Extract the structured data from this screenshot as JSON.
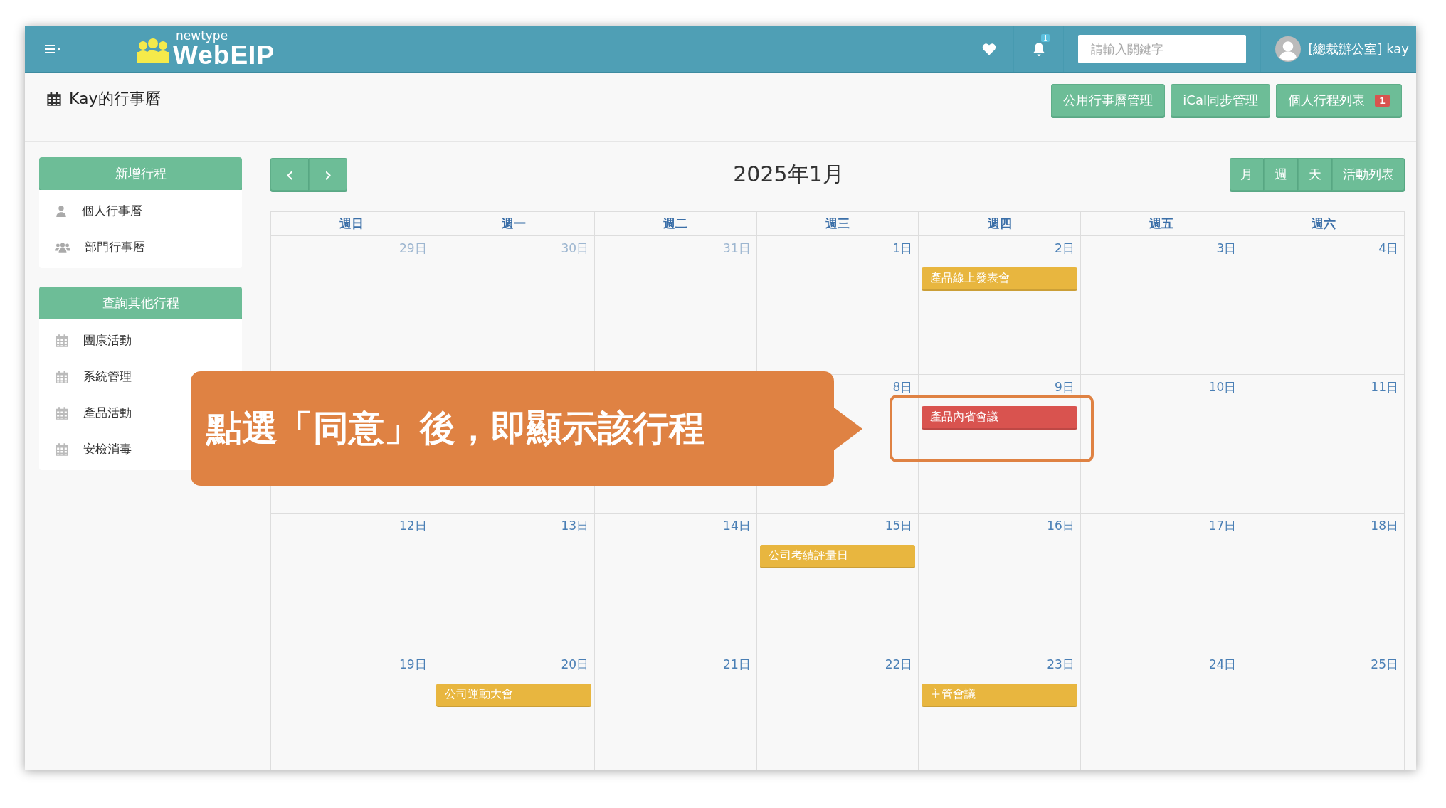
{
  "header": {
    "logo_small": "newtype",
    "logo_big": "WebEIP",
    "notification_count": "1",
    "search": {
      "placeholder": "請輸入關鍵字"
    },
    "user": "[總裁辦公室] kay"
  },
  "page_title": "Kay的行事曆",
  "top_buttons": [
    {
      "label": "公用行事曆管理"
    },
    {
      "label": "iCal同步管理"
    },
    {
      "label": "個人行程列表",
      "badge": "1"
    }
  ],
  "sidebar": [
    {
      "title": "新增行程",
      "items": [
        {
          "kind": "person",
          "label": "個人行事曆"
        },
        {
          "kind": "group",
          "label": "部門行事曆"
        }
      ]
    },
    {
      "title": "查詢其他行程",
      "items": [
        {
          "kind": "calendar",
          "label": "團康活動"
        },
        {
          "kind": "calendar",
          "label": "系統管理"
        },
        {
          "kind": "calendar",
          "label": "產品活動"
        },
        {
          "kind": "calendar",
          "label": "安檢消毒"
        }
      ]
    }
  ],
  "calendar": {
    "title": "2025年1月",
    "nav": [
      "‹",
      "›"
    ],
    "views": [
      "月",
      "週",
      "天",
      "活動列表"
    ],
    "weekdays": [
      "週日",
      "週一",
      "週二",
      "週三",
      "週四",
      "週五",
      "週六"
    ],
    "weeks": [
      {
        "days": [
          {
            "label": "29日",
            "muted": true
          },
          {
            "label": "30日",
            "muted": true
          },
          {
            "label": "31日",
            "muted": true
          },
          {
            "label": "1日",
            "muted": false
          },
          {
            "label": "2日",
            "muted": false,
            "events": [
              {
                "title": "產品線上發表會",
                "color": "#e8b63f"
              }
            ]
          },
          {
            "label": "3日",
            "muted": false
          },
          {
            "label": "4日",
            "muted": false
          }
        ]
      },
      {
        "days": [
          {
            "label": "8日",
            "muted": false
          },
          {
            "label": "9日",
            "muted": false,
            "events": [
              {
                "title": "產品內省會議",
                "color": "#d9534f"
              }
            ]
          },
          {
            "label": "10日",
            "muted": false
          },
          {
            "label": "11日",
            "muted": false
          }
        ]
      },
      {
        "days": [
          {
            "label": "12日",
            "muted": false
          },
          {
            "label": "13日",
            "muted": false
          },
          {
            "label": "14日",
            "muted": false
          },
          {
            "label": "15日",
            "muted": false,
            "events": [
              {
                "title": "公司考績評量日",
                "color": "#e8b63f"
              }
            ]
          },
          {
            "label": "16日",
            "muted": false
          },
          {
            "label": "17日",
            "muted": false
          },
          {
            "label": "18日",
            "muted": false
          }
        ]
      },
      {
        "days": [
          {
            "label": "19日",
            "muted": false
          },
          {
            "label": "20日",
            "muted": false,
            "events": [
              {
                "title": "公司運動大會",
                "color": "#e8b63f"
              }
            ]
          },
          {
            "label": "21日",
            "muted": false
          },
          {
            "label": "22日",
            "muted": false
          },
          {
            "label": "23日",
            "muted": false,
            "events": [
              {
                "title": "主管會議",
                "color": "#e8b63f"
              }
            ]
          },
          {
            "label": "24日",
            "muted": false
          },
          {
            "label": "25日",
            "muted": false
          }
        ]
      }
    ]
  },
  "callout": {
    "text": "點選「同意」後，即顯示該行程"
  }
}
